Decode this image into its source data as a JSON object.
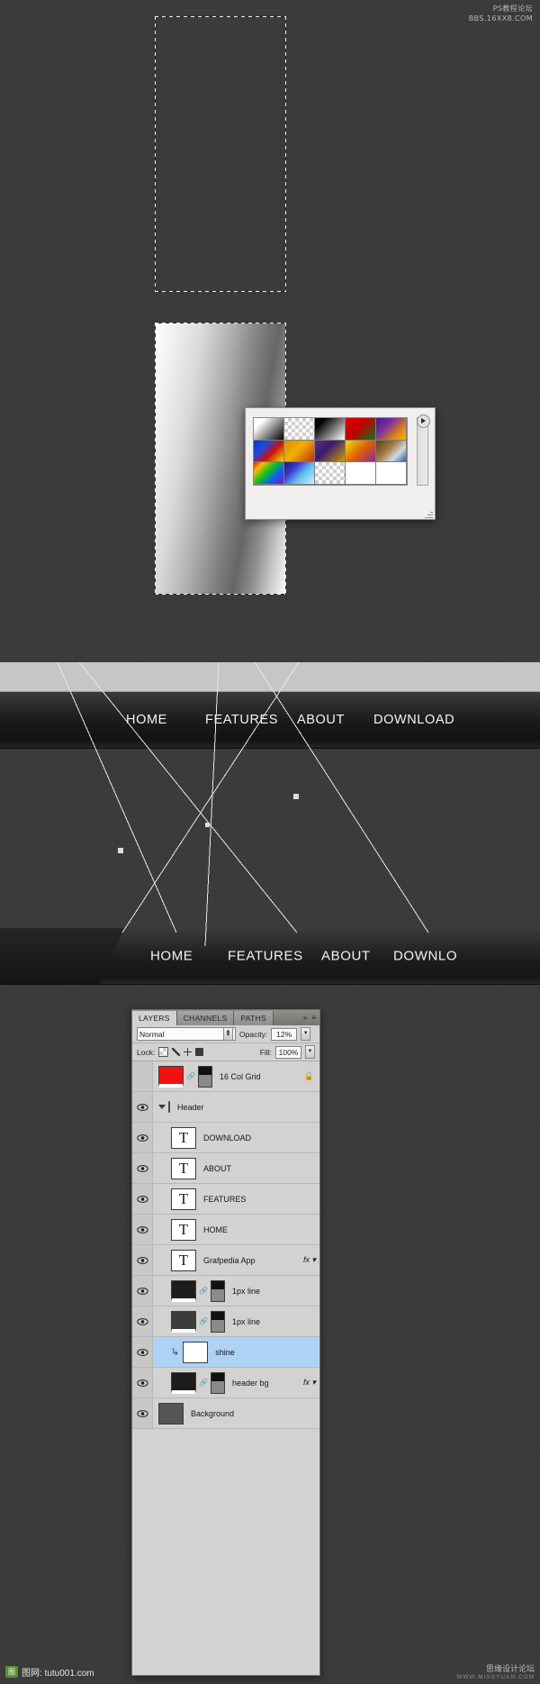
{
  "watermarks": {
    "top_right_line1": "PS教程论坛",
    "top_right_line2": "BBS.16XX8.COM",
    "bottom_left_badge": "图",
    "bottom_left_text": "图网: tutu001.com",
    "bottom_right_line1": "思缘设计论坛",
    "bottom_right_line2": "WWW.MISSYUAN.COM"
  },
  "gradient_picker": {
    "name": "gradient-picker-popup",
    "arrow_label": "▶",
    "swatches": [
      {
        "name": "foreground-to-background",
        "css": "linear-gradient(135deg,#ffffff 0%,#ffffff 22%,#000000 100%)"
      },
      {
        "name": "foreground-to-transparent",
        "css": "checker"
      },
      {
        "name": "black-white",
        "css": "linear-gradient(135deg,#000000 0%,#000000 20%,#ffffff 100%)"
      },
      {
        "name": "red-green",
        "css": "linear-gradient(135deg,#e00000 0%,#c00000 45%,#0a7a18 100%)"
      },
      {
        "name": "violet-orange",
        "css": "linear-gradient(135deg,#3a1a8f 0%,#7a2f9a 35%,#e08a10 75%,#f0c000 100%)"
      },
      {
        "name": "blue-red-yellow",
        "css": "linear-gradient(135deg,#0b35c8 0%,#1a4ae0 30%,#c81010 60%,#f2e000 100%)"
      },
      {
        "name": "blue-yellow-blue",
        "css": "linear-gradient(135deg,#e08a00 0%,#f0b000 45%,#c03000 100%)"
      },
      {
        "name": "orange-yellow-orange",
        "css": "linear-gradient(135deg,#5a2a8f 0%,#3a1a6f 40%,#c8a000 100%)"
      },
      {
        "name": "violet-green-orange",
        "css": "linear-gradient(135deg,#f0e000 0%,#e06000 50%,#8a2a9a 100%)"
      },
      {
        "name": "yellow-violet-orange-blue",
        "css": "linear-gradient(135deg,#5a3a1a 0%,#a07a40 40%,#cfd8e8 70%,#2a5aa0 100%)"
      },
      {
        "name": "copper",
        "css": "linear-gradient(135deg,#e01010 0%,#f0c000 20%,#10c020 45%,#1060f0 70%,#8a10d0 100%)"
      },
      {
        "name": "chrome",
        "css": "linear-gradient(135deg,#1a1a6a 0%,#3a3ad0 30%,#60c0f0 60%,#d0f0ff 100%)"
      },
      {
        "name": "spectrum",
        "css": "checker"
      },
      {
        "name": "transparent-rainbow",
        "css": "#ffffff"
      },
      {
        "name": "transparent-stripes",
        "css": "#ffffff"
      }
    ]
  },
  "nav1": {
    "name": "header-nav-preview-1",
    "items": [
      "HOME",
      "FEATURES",
      "ABOUT",
      "DOWNLOAD"
    ]
  },
  "nav2": {
    "name": "header-nav-preview-2",
    "items": [
      "HOME",
      "FEATURES",
      "ABOUT",
      "DOWNLO"
    ]
  },
  "layers_panel": {
    "tabs": [
      {
        "label": "LAYERS",
        "active": true
      },
      {
        "label": "CHANNELS",
        "active": false
      },
      {
        "label": "PATHS",
        "active": false
      }
    ],
    "collapse_icon": "»",
    "menu_icon": "≡",
    "blend_mode": "Normal",
    "opacity_label": "Opacity:",
    "opacity_value": "12%",
    "lock_label": "Lock:",
    "fill_label": "Fill:",
    "fill_value": "100%",
    "lock_icons": [
      "transparency-lock-icon",
      "brush-lock-icon",
      "move-lock-icon",
      "all-lock-icon"
    ],
    "rows": [
      {
        "name": "16 Col Grid",
        "kind": "fill",
        "visible": false,
        "selected": false,
        "thumb": "red",
        "has_mask": true,
        "has_link": true,
        "locked": true,
        "fx": false,
        "indent": 0
      },
      {
        "name": "Header",
        "kind": "group",
        "visible": true,
        "selected": false,
        "thumb": "folder",
        "has_mask": false,
        "has_link": false,
        "locked": false,
        "fx": false,
        "indent": 0
      },
      {
        "name": "DOWNLOAD",
        "kind": "text",
        "visible": true,
        "selected": false,
        "thumb": "T",
        "has_mask": false,
        "has_link": false,
        "locked": false,
        "fx": false,
        "indent": 1
      },
      {
        "name": "ABOUT",
        "kind": "text",
        "visible": true,
        "selected": false,
        "thumb": "T",
        "has_mask": false,
        "has_link": false,
        "locked": false,
        "fx": false,
        "indent": 1
      },
      {
        "name": "FEATURES",
        "kind": "text",
        "visible": true,
        "selected": false,
        "thumb": "T",
        "has_mask": false,
        "has_link": false,
        "locked": false,
        "fx": false,
        "indent": 1
      },
      {
        "name": "HOME",
        "kind": "text",
        "visible": true,
        "selected": false,
        "thumb": "T",
        "has_mask": false,
        "has_link": false,
        "locked": false,
        "fx": false,
        "indent": 1
      },
      {
        "name": "Grafpedia App",
        "kind": "text",
        "visible": true,
        "selected": false,
        "thumb": "T",
        "has_mask": false,
        "has_link": false,
        "locked": false,
        "fx": true,
        "indent": 1
      },
      {
        "name": "1px line",
        "kind": "fill",
        "visible": true,
        "selected": false,
        "thumb": "dark",
        "has_mask": true,
        "has_link": true,
        "locked": false,
        "fx": false,
        "indent": 1
      },
      {
        "name": "1px line",
        "kind": "fill",
        "visible": true,
        "selected": false,
        "thumb": "dark2",
        "has_mask": true,
        "has_link": true,
        "locked": false,
        "fx": false,
        "indent": 1
      },
      {
        "name": "shine",
        "kind": "clipped",
        "visible": true,
        "selected": true,
        "thumb": "checker",
        "has_mask": false,
        "has_link": false,
        "locked": false,
        "fx": false,
        "indent": 1
      },
      {
        "name": "header bg",
        "kind": "fill",
        "visible": true,
        "selected": false,
        "thumb": "dark",
        "has_mask": true,
        "has_link": true,
        "locked": false,
        "fx": true,
        "indent": 1
      },
      {
        "name": "Background",
        "kind": "background",
        "visible": true,
        "selected": false,
        "thumb": "gray",
        "has_mask": false,
        "has_link": false,
        "locked": false,
        "fx": false,
        "indent": 0
      }
    ],
    "fx_label": "fx",
    "lock_glyph": "🔒"
  },
  "colors": {
    "canvas_bg": "#3a3a3a",
    "nav_dark": "#1a1a1a",
    "light_strip": "#c6c6c6",
    "panel_bg": "#d3d2d0",
    "selection_blue": "#aed2f5",
    "grid_red": "#f21010"
  }
}
